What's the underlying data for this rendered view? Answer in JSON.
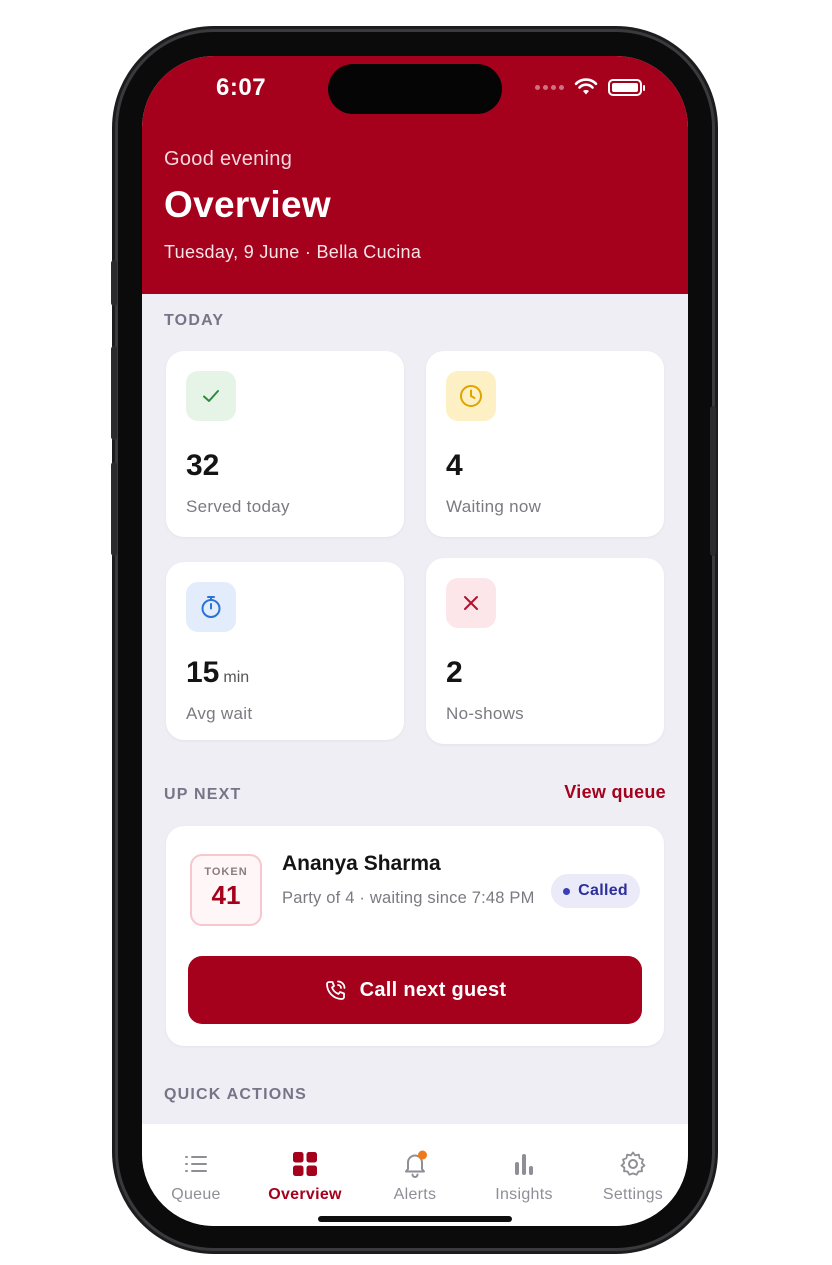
{
  "status": {
    "time": "6:07"
  },
  "header": {
    "greeting": "Good evening",
    "title": "Overview",
    "subtitle": "Tuesday, 9 June · Bella Cucina"
  },
  "today": {
    "section_label": "TODAY",
    "stats": [
      {
        "icon": "check-icon",
        "value": "32",
        "unit": "",
        "label": "Served today",
        "icon_bg": "#e6f4e8",
        "icon_color": "#2e8b3a"
      },
      {
        "icon": "clock-icon",
        "value": "4",
        "unit": "",
        "label": "Waiting now",
        "icon_bg": "#fdf0c4",
        "icon_color": "#e0a400"
      },
      {
        "icon": "stopwatch-icon",
        "value": "15",
        "unit": "min",
        "label": "Avg wait",
        "icon_bg": "#e2ecfb",
        "icon_color": "#2a72d6"
      },
      {
        "icon": "x-icon",
        "value": "2",
        "unit": "",
        "label": "No-shows",
        "icon_bg": "#fde6e9",
        "icon_color": "#b5102a"
      }
    ]
  },
  "up_next": {
    "section_label": "UP NEXT",
    "view_queue_label": "View queue",
    "token_label": "TOKEN",
    "token_number": "41",
    "guest_name": "Ananya Sharma",
    "guest_detail": "Party of 4 · waiting since 7:48 PM",
    "status_badge": "Called",
    "call_button_label": "Call next guest"
  },
  "quick_actions": {
    "section_label": "QUICK ACTIONS"
  },
  "tabbar": {
    "items": [
      {
        "label": "Queue",
        "icon": "list-icon"
      },
      {
        "label": "Overview",
        "icon": "grid-icon",
        "active": true
      },
      {
        "label": "Alerts",
        "icon": "bell-icon"
      },
      {
        "label": "Insights",
        "icon": "bar-chart-icon"
      },
      {
        "label": "Settings",
        "icon": "gear-icon"
      }
    ]
  },
  "colors": {
    "brand": "#a5001c",
    "background": "#f0eef5",
    "alert_dot": "#f07a1a"
  }
}
